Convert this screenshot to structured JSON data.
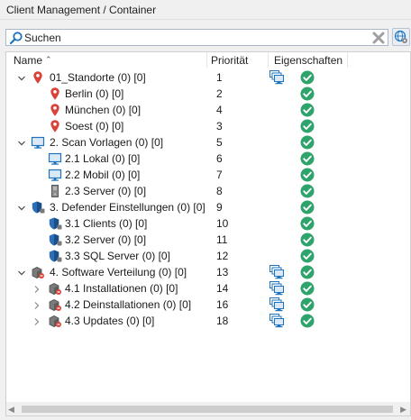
{
  "window": {
    "title": "Client Management / Container"
  },
  "search": {
    "placeholder": "Suchen"
  },
  "columns": {
    "name": "Name",
    "priority": "Priorität",
    "properties": "Eigenschaften"
  },
  "rows": [
    {
      "level": 0,
      "expander": "expanded",
      "icon": "location-pin-icon",
      "label": "01_Standorte (0) [0]",
      "priority": "1",
      "prop_icon": true,
      "ok": true
    },
    {
      "level": 1,
      "expander": "none",
      "icon": "location-pin-icon",
      "label": "Berlin (0) [0]",
      "priority": "2",
      "prop_icon": false,
      "ok": true
    },
    {
      "level": 1,
      "expander": "none",
      "icon": "location-pin-icon",
      "label": "München (0) [0]",
      "priority": "4",
      "prop_icon": false,
      "ok": true
    },
    {
      "level": 1,
      "expander": "none",
      "icon": "location-pin-icon",
      "label": "Soest (0) [0]",
      "priority": "3",
      "prop_icon": false,
      "ok": true
    },
    {
      "level": 0,
      "expander": "expanded",
      "icon": "monitor-icon",
      "label": "2. Scan Vorlagen (0) [0]",
      "priority": "5",
      "prop_icon": false,
      "ok": true
    },
    {
      "level": 1,
      "expander": "none",
      "icon": "monitor-icon",
      "label": "2.1 Lokal (0) [0]",
      "priority": "6",
      "prop_icon": false,
      "ok": true
    },
    {
      "level": 1,
      "expander": "none",
      "icon": "monitor-icon",
      "label": "2.2 Mobil (0) [0]",
      "priority": "7",
      "prop_icon": false,
      "ok": true
    },
    {
      "level": 1,
      "expander": "none",
      "icon": "server-tower-icon",
      "label": "2.3 Server (0) [0]",
      "priority": "8",
      "prop_icon": false,
      "ok": true
    },
    {
      "level": 0,
      "expander": "expanded",
      "icon": "defender-shield-icon",
      "label": "3. Defender Einstellungen (0) [0]",
      "priority": "9",
      "prop_icon": false,
      "ok": true
    },
    {
      "level": 1,
      "expander": "none",
      "icon": "defender-shield-icon",
      "label": "3.1 Clients (0) [0]",
      "priority": "10",
      "prop_icon": false,
      "ok": true
    },
    {
      "level": 1,
      "expander": "none",
      "icon": "defender-shield-icon",
      "label": "3.2 Server (0) [0]",
      "priority": "11",
      "prop_icon": false,
      "ok": true
    },
    {
      "level": 1,
      "expander": "none",
      "icon": "defender-shield-icon",
      "label": "3.3 SQL Server (0) [0]",
      "priority": "12",
      "prop_icon": false,
      "ok": true
    },
    {
      "level": 0,
      "expander": "expanded",
      "icon": "software-package-icon",
      "label": "4. Software Verteilung (0) [0]",
      "priority": "13",
      "prop_icon": true,
      "ok": true
    },
    {
      "level": 1,
      "expander": "collapsed",
      "icon": "software-package-icon",
      "label": "4.1 Installationen (0) [0]",
      "priority": "14",
      "prop_icon": true,
      "ok": true
    },
    {
      "level": 1,
      "expander": "collapsed",
      "icon": "software-package-icon",
      "label": "4.2 Deinstallationen (0) [0]",
      "priority": "16",
      "prop_icon": true,
      "ok": true
    },
    {
      "level": 1,
      "expander": "collapsed",
      "icon": "software-package-icon",
      "label": "4.3 Updates (0) [0]",
      "priority": "18",
      "prop_icon": true,
      "ok": true
    }
  ],
  "colors": {
    "accent": "#1e73be",
    "ok": "#2ea36b",
    "pin": "#d9443a"
  }
}
